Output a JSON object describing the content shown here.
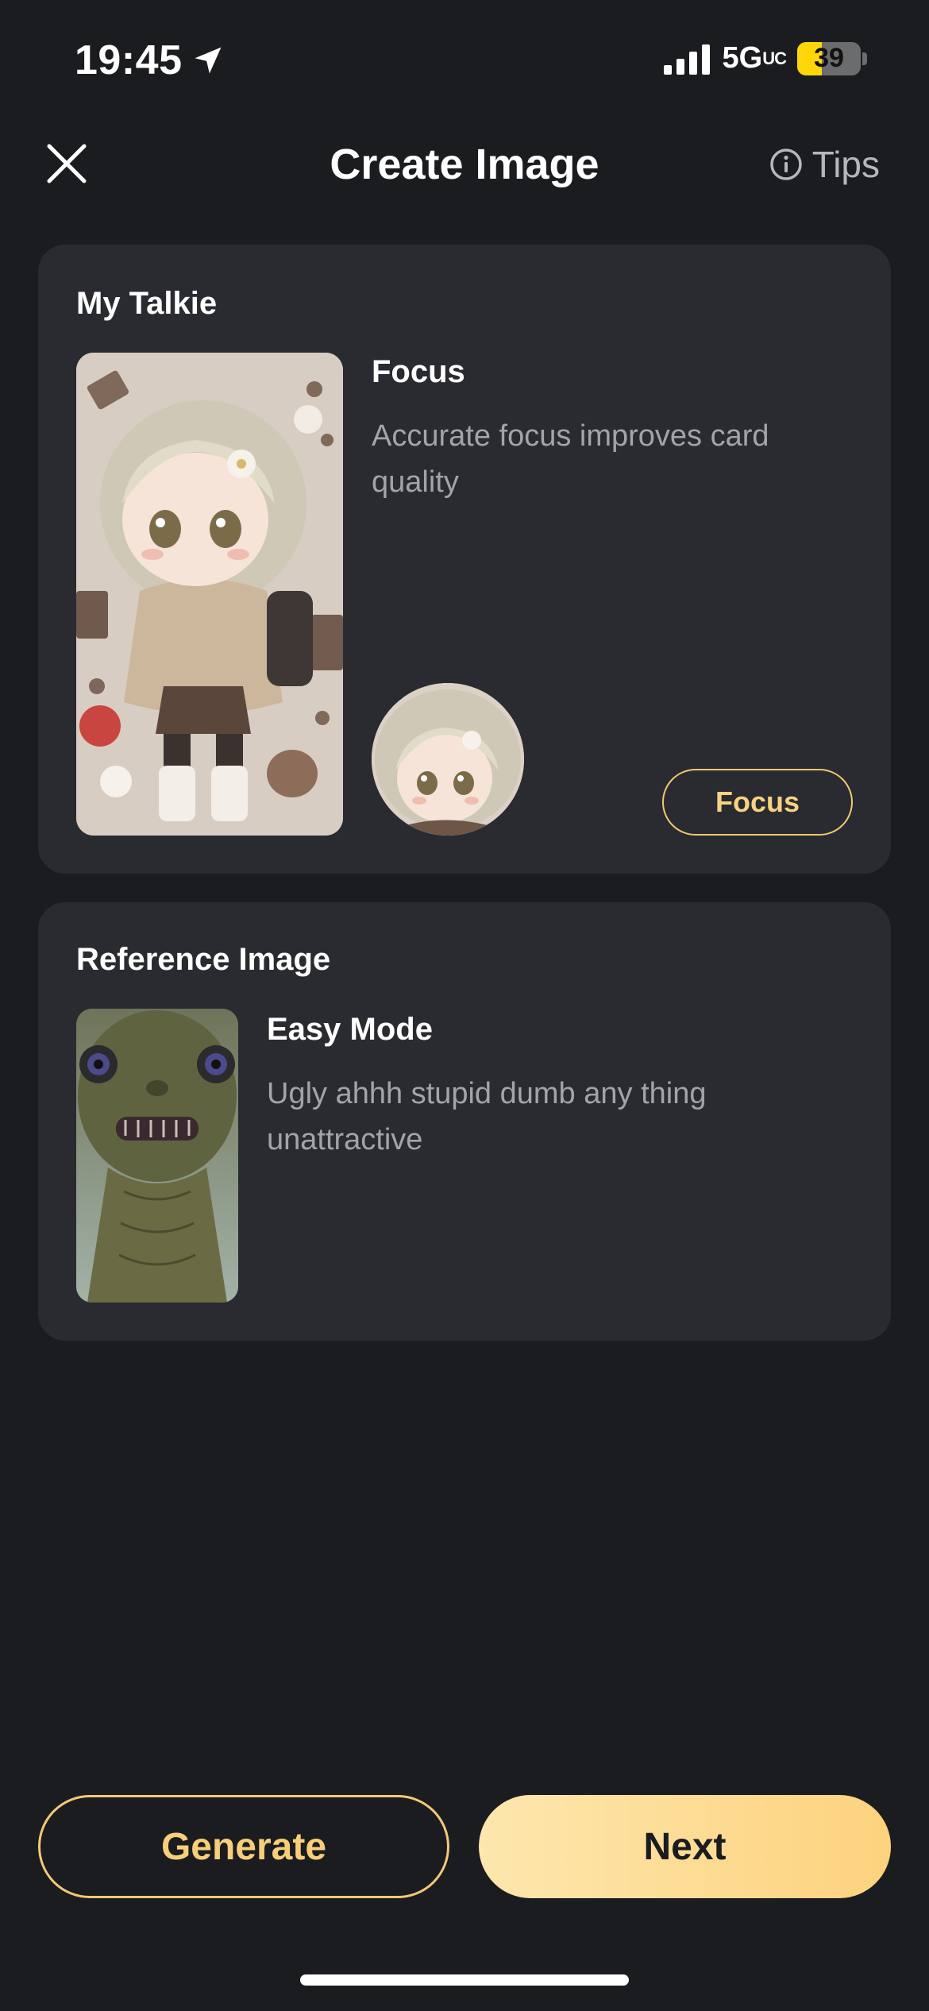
{
  "status_bar": {
    "time": "19:45",
    "network": "5G",
    "network_sub": "UC",
    "battery": "39",
    "battery_fraction": 0.39,
    "location_icon": "location-arrow-icon",
    "signal_icon": "cellular-signal-icon"
  },
  "header": {
    "title": "Create Image",
    "close_icon": "close-icon",
    "tips_label": "Tips",
    "tips_icon": "info-icon"
  },
  "talkie": {
    "heading": "My Talkie",
    "focus_title": "Focus",
    "focus_desc": "Accurate focus improves card quality",
    "focus_button": "Focus"
  },
  "reference": {
    "heading": "Reference Image",
    "mode_title": "Easy Mode",
    "mode_desc": "Ugly ahhh stupid dumb any thing unattractive"
  },
  "actions": {
    "generate": "Generate",
    "next": "Next"
  },
  "colors": {
    "background": "#1b1c20",
    "card": "#2a2b30",
    "accent": "#f7d282",
    "battery_fill": "#ffd60a"
  }
}
